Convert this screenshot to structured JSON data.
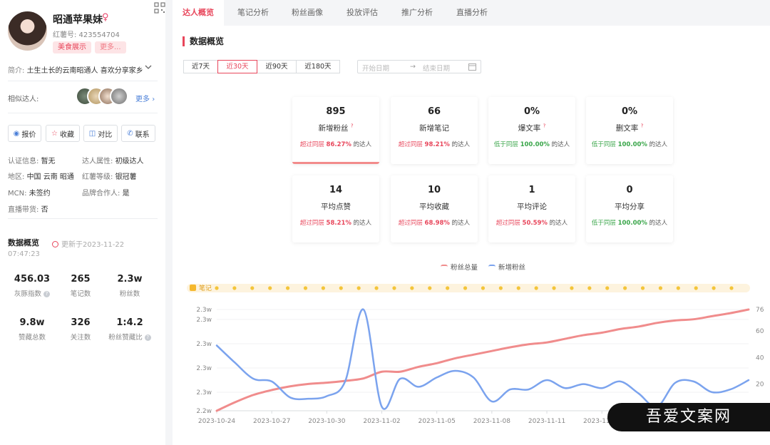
{
  "profile": {
    "name": "昭通苹果妹",
    "gender_icon": "♀",
    "redbook_id": "红薯号: 423554704",
    "tags": [
      "美食展示",
      "更多..."
    ],
    "intro_label": "简介: ",
    "intro_text": "土生土长的云南昭通人 喜欢分享家乡",
    "similar_label": "相似达人:",
    "similar_more": "更多",
    "actions": [
      "报价",
      "收藏",
      "对比",
      "联系"
    ],
    "info": {
      "cert_k": "认证信息: ",
      "cert_v": "暂无",
      "attr_k": "达人属性: ",
      "attr_v": "初级达人",
      "region_k": "地区: ",
      "region_v": "中国 云南 昭通",
      "level_k": "红薯等级: ",
      "level_v": "银冠薯",
      "mcn_k": "MCN: ",
      "mcn_v": "未签约",
      "brand_k": "品牌合作人: ",
      "brand_v": "是",
      "live_k": "直播带货: ",
      "live_v": "否"
    },
    "overview_title": "数据概览",
    "updated": "更新于2023-11-22",
    "updated_time": "07:47:23",
    "stats": [
      {
        "value": "456.03",
        "label": "灰豚指数",
        "help": "?"
      },
      {
        "value": "265",
        "label": "笔记数",
        "help": ""
      },
      {
        "value": "2.3w",
        "label": "粉丝数",
        "help": ""
      },
      {
        "value": "9.8w",
        "label": "赞藏总数",
        "help": ""
      },
      {
        "value": "326",
        "label": "关注数",
        "help": ""
      },
      {
        "value": "1:4.2",
        "label": "粉丝赞藏比",
        "help": "?"
      }
    ]
  },
  "tabs": [
    "达人概览",
    "笔记分析",
    "粉丝画像",
    "投放评估",
    "推广分析",
    "直播分析"
  ],
  "main": {
    "title": "数据概览",
    "ranges": [
      "近7天",
      "近30天",
      "近90天",
      "近180天"
    ],
    "date_start": "开始日期",
    "date_arrow": "→",
    "date_end": "结束日期",
    "cards": [
      {
        "value": "895",
        "label": "新增粉丝",
        "help": "?",
        "prefix": "超过同层",
        "pct": "86.27%",
        "suffix": " 的达人",
        "trend": "up"
      },
      {
        "value": "66",
        "label": "新增笔记",
        "help": "",
        "prefix": "超过同层",
        "pct": "98.21%",
        "suffix": " 的达人",
        "trend": "up"
      },
      {
        "value": "0%",
        "label": "爆文率",
        "help": "?",
        "prefix": "低于同层",
        "pct": "100.00%",
        "suffix": " 的达人",
        "trend": "down"
      },
      {
        "value": "0%",
        "label": "删文率",
        "help": "?",
        "prefix": "低于同层",
        "pct": "100.00%",
        "suffix": " 的达人",
        "trend": "down"
      },
      {
        "value": "14",
        "label": "平均点赞",
        "help": "",
        "prefix": "超过同层",
        "pct": "58.21%",
        "suffix": " 的达人",
        "trend": "up"
      },
      {
        "value": "10",
        "label": "平均收藏",
        "help": "",
        "prefix": "超过同层",
        "pct": "68.98%",
        "suffix": " 的达人",
        "trend": "up"
      },
      {
        "value": "1",
        "label": "平均评论",
        "help": "",
        "prefix": "超过同层",
        "pct": "50.59%",
        "suffix": " 的达人",
        "trend": "up"
      },
      {
        "value": "0",
        "label": "平均分享",
        "help": "",
        "prefix": "低于同层",
        "pct": "100.00%",
        "suffix": " 的达人",
        "trend": "down"
      }
    ]
  },
  "chart_data": {
    "type": "line",
    "legend": [
      "粉丝总量",
      "新增粉丝"
    ],
    "note_track_label": "笔记",
    "note_markers": 30,
    "x_tick_labels": [
      "2023-10-24",
      "2023-10-27",
      "2023-10-30",
      "2023-11-02",
      "2023-11-05",
      "2023-11-08",
      "2023-11-11",
      "2023-11-14"
    ],
    "y_left_tick_labels": [
      "2.3w",
      "2.3w",
      "2.3w",
      "2.3w",
      "2.3w",
      "2.2w"
    ],
    "y_right_tick_labels": [
      "76",
      "60",
      "40",
      "20"
    ],
    "y_right_range": [
      0,
      76
    ],
    "series": [
      {
        "name": "粉丝总量",
        "axis": "left",
        "values": [
          22150,
          22220,
          22280,
          22320,
          22350,
          22370,
          22380,
          22395,
          22415,
          22470,
          22470,
          22510,
          22540,
          22580,
          22610,
          22640,
          22670,
          22695,
          22710,
          22740,
          22770,
          22790,
          22820,
          22840,
          22870,
          22890,
          22900,
          22925,
          22950,
          22980
        ]
      },
      {
        "name": "新增粉丝",
        "axis": "right",
        "values": [
          49,
          36,
          24,
          22,
          10,
          9,
          11,
          22,
          76,
          3,
          24,
          18,
          25,
          30,
          25,
          7,
          16,
          16,
          23,
          17,
          20,
          17,
          22,
          13,
          3,
          21,
          22,
          14,
          16,
          23
        ]
      }
    ],
    "colors": {
      "粉丝总量": "#f08c8c",
      "新增粉丝": "#7ba3ee"
    }
  },
  "watermark": "吾爱文案网"
}
